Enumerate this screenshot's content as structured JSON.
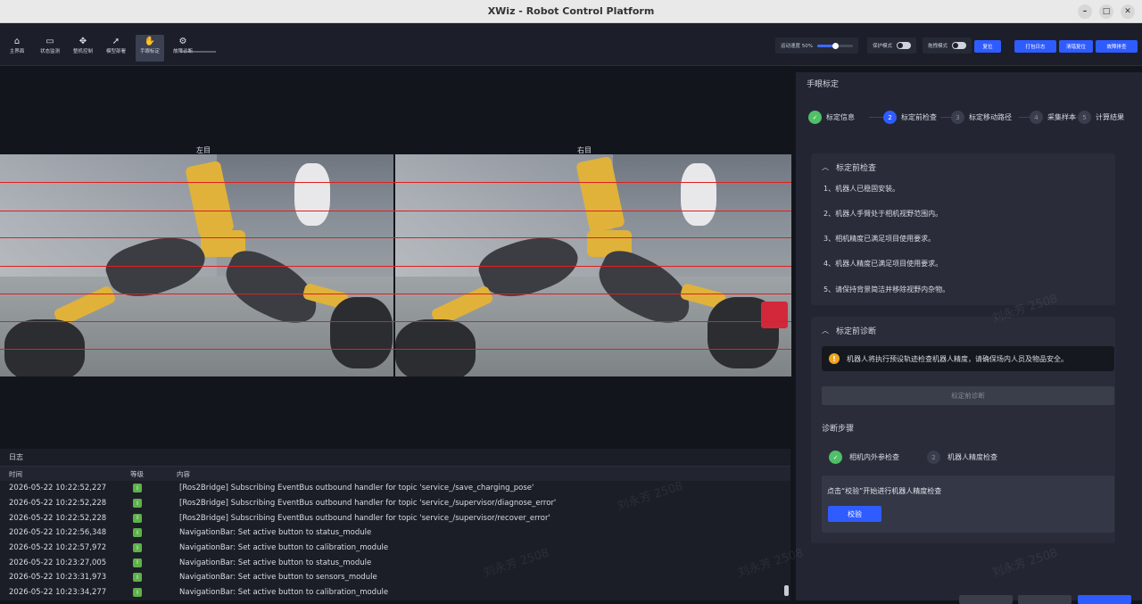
{
  "window": {
    "title": "XWiz - Robot Control Platform",
    "controls": [
      "–",
      "□",
      "✕"
    ]
  },
  "nav": [
    {
      "label": "主界面",
      "icon": "home-icon",
      "glyph": "⌂"
    },
    {
      "label": "状态监测",
      "icon": "monitor-icon",
      "glyph": "▭"
    },
    {
      "label": "整机控制",
      "icon": "robot-icon",
      "glyph": "✥"
    },
    {
      "label": "模型部署",
      "icon": "rocket-icon",
      "glyph": "➚"
    },
    {
      "label": "手眼标定",
      "icon": "hand-eye-icon",
      "glyph": "✋"
    },
    {
      "label": "故障诊断",
      "icon": "diagnosis-icon",
      "glyph": "⚙"
    }
  ],
  "toolbar": {
    "speed_label": "运动速度 50%",
    "speed_value": 0.5,
    "protect_label": "保护模式",
    "drag_label": "拖拽模式",
    "reset_label": "复位",
    "open_log_label": "打包日志",
    "clear_error_label": "清错复位",
    "fault_label": "故障排查"
  },
  "camera": {
    "left_label": "左目",
    "right_label": "右目"
  },
  "log": {
    "title": "日志",
    "columns": {
      "time": "时间",
      "level": "等级",
      "content": "内容"
    },
    "level_glyph": "I",
    "rows": [
      {
        "time": "2026-05-22 10:22:52,227",
        "msg": "[Ros2Bridge] Subscribing EventBus outbound handler for topic 'service_/save_charging_pose'"
      },
      {
        "time": "2026-05-22 10:22:52,228",
        "msg": "[Ros2Bridge] Subscribing EventBus outbound handler for topic 'service_/supervisor/diagnose_error'"
      },
      {
        "time": "2026-05-22 10:22:52,228",
        "msg": "[Ros2Bridge] Subscribing EventBus outbound handler for topic 'service_/supervisor/recover_error'"
      },
      {
        "time": "2026-05-22 10:22:56,348",
        "msg": "NavigationBar: Set active button to status_module"
      },
      {
        "time": "2026-05-22 10:22:57,972",
        "msg": "NavigationBar: Set active button to calibration_module"
      },
      {
        "time": "2026-05-22 10:23:27,005",
        "msg": "NavigationBar: Set active button to status_module"
      },
      {
        "time": "2026-05-22 10:23:31,973",
        "msg": "NavigationBar: Set active button to sensors_module"
      },
      {
        "time": "2026-05-22 10:23:34,277",
        "msg": "NavigationBar: Set active button to calibration_module"
      }
    ]
  },
  "calibration": {
    "title": "手眼标定",
    "steps": [
      {
        "num": "✓",
        "label": "标定信息",
        "state": "done"
      },
      {
        "num": "2",
        "label": "标定前检查",
        "state": "cur"
      },
      {
        "num": "3",
        "label": "标定移动路径",
        "state": "todo"
      },
      {
        "num": "4",
        "label": "采集样本",
        "state": "todo"
      },
      {
        "num": "5",
        "label": "计算结果",
        "state": "todo"
      }
    ],
    "precheck": {
      "title": "标定前检查",
      "items": [
        "1、机器人已稳固安装。",
        "2、机器人手臂处于相机视野范围内。",
        "3、相机精度已满足项目使用要求。",
        "4、机器人精度已满足项目使用要求。",
        "5、请保持背景简洁并移除视野内杂物。"
      ]
    },
    "diagnosis": {
      "title": "标定前诊断",
      "warning": "机器人将执行预设轨迹检查机器人精度，请确保场内人员及物品安全。",
      "button": "标定前诊断",
      "steps_label": "诊断步骤",
      "step1": {
        "num": "✓",
        "label": "相机内外参检查"
      },
      "step2": {
        "num": "2",
        "label": "机器人精度检查"
      },
      "hint": "点击“校验”开始进行机器人精度检查",
      "check_button": "校验"
    }
  },
  "watermark": "刘永芳 2508",
  "colors": {
    "accent": "#2f5cff",
    "success": "#4fbf68",
    "warning": "#f0a51d",
    "gridline": "#e02020"
  }
}
